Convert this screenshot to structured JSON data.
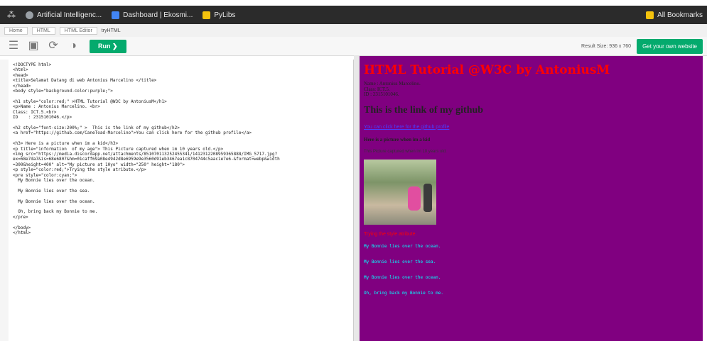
{
  "bookmarks": {
    "items": [
      {
        "label": "Artificial Intelligenc...",
        "icon": "globe-icon",
        "color": "#9aa0a6"
      },
      {
        "label": "Dashboard | Ekosmi...",
        "icon": "dashboard-icon",
        "color": "#4285f4"
      },
      {
        "label": "PyLibs",
        "icon": "folder-icon",
        "color": "#f4c20d"
      }
    ],
    "all_bookmarks": "All Bookmarks"
  },
  "breadcrumb": [
    "Home",
    "HTML",
    "HTML Editor",
    "tryHTML"
  ],
  "toolbar": {
    "run_label": "Run ❯",
    "result_size": "Result Size: 936 x 760",
    "get_site": "Get your own website"
  },
  "editor": {
    "lines": [
      "<!DOCTYPE html>",
      "<html>",
      "<head>",
      "<title>Selamat Datang di web Antonius Marcelino </title>",
      "</head>",
      "<body style=\"background-color:purple;\">",
      "",
      "<h1 style=\"color:red;\" >HTML Tutorial @W3C by AntoniusM</h1>",
      "<p>Name : Antonius Marcelino. <br>",
      "Class: ICT.5.<br>",
      "ID    : 2315101046.</p>",
      "",
      "<h2 style=\"font-size:200%;\" >  This is the link of my github</h2>",
      "<a href=\"https://github.com/CaneToad-Marcelino\">You can click here for the github profile</a>",
      "",
      "<h3> Here is a picture when im a kid</h3>",
      "<p title=\"information  of my age\"> This Picture captured when im 10 years old.</p>",
      "<img src=\"https://media.discordapp.net/attachments/851070113252455341/1412312208959365888/IMG_5717.jpg?",
      "ex=68e7da7&is=68e6807&hm=01caff69a08e4942d8e6959e9e3560d91eb3467ea1c8704744c5aac1e7e6-&format=webp&width",
      "=300&height=400\" alt=\"My picture at 10yo\" width=\"250\" height=\"180\">",
      "<p style=\"color:red;\">Trying the style atribute.</p>",
      "<pre style=\"color:cyan;\">",
      "  My Bonnie lies over the ocean.",
      "",
      "  My Bonnie lies over the sea.",
      "",
      "  My Bonnie lies over the ocean.",
      "",
      "  Oh, bring back my Bonnie to me.",
      "</pre>",
      "",
      "</body>",
      "</html>"
    ]
  },
  "result": {
    "h1": "HTML Tutorial @W3C by AntoniusM",
    "info": [
      "Name : Antonius Marcelino.",
      "Class: ICT.5.",
      "ID    : 2315101046."
    ],
    "h2": "This is the link of my github",
    "link": "You can click here for the github profile",
    "h3": "Here is a picture when im a kid",
    "caption": "This Picture captured when im 10 years old.",
    "styled": "Trying the style atribute.",
    "pre": [
      "My Bonnie lies over the ocean.",
      "My Bonnie lies over the sea.",
      "My Bonnie lies over the ocean.",
      "Oh, bring back my Bonnie to me."
    ],
    "bg_color": "#800080"
  }
}
